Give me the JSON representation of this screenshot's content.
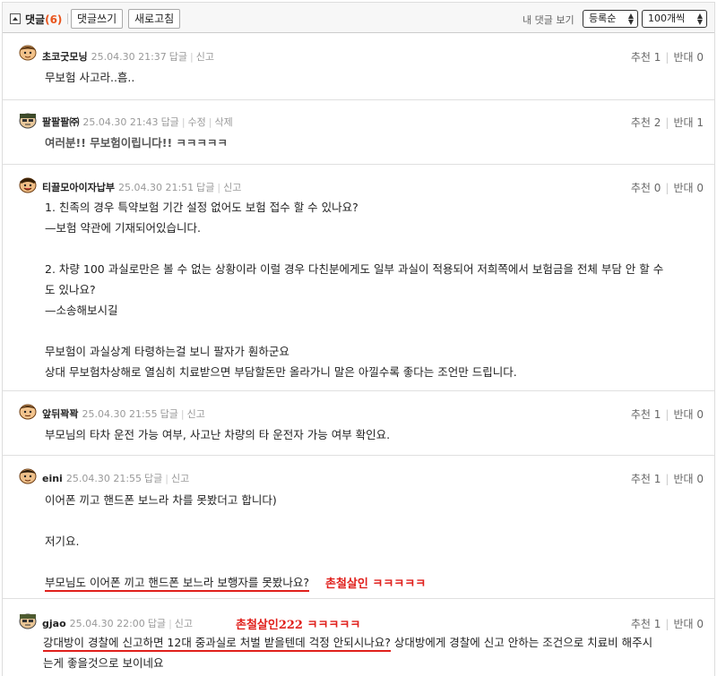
{
  "header": {
    "title": "댓글",
    "count": "(6)",
    "write_button": "댓글쓰기",
    "refresh_button": "새로고침",
    "my_comments": "내 댓글 보기",
    "sort_value": "등록순",
    "per_page_value": "100개씩"
  },
  "comments": [
    {
      "nick": "초코굿모닝",
      "date": "25.04.30 21:37",
      "links": [
        "답글",
        "신고"
      ],
      "up_label": "추천 1",
      "down_label": "반대 0",
      "body": "무보험 사고라..흠.."
    },
    {
      "nick": "팔팔팔㈜",
      "date": "25.04.30 21:43",
      "links": [
        "답글",
        "수정",
        "삭제"
      ],
      "up_label": "추천 2",
      "down_label": "반대 1",
      "body": "여러분!! 무보험이립니다!! ㅋㅋㅋㅋㅋ"
    },
    {
      "nick": "티끌모아이자납부",
      "date": "25.04.30 21:51",
      "links": [
        "답글",
        "신고"
      ],
      "up_label": "추천 0",
      "down_label": "반대 0",
      "body": "1. 친족의 경우 특약보험 기간 설정 없어도 보험 접수 할 수 있나요?\n—보험 약관에 기재되어있습니다.\n\n2. 차량 100 과실로만은 볼 수 없는 상황이라 이럴 경우 다친분에게도 일부 과실이 적용되어 저희쪽에서 보험금을 전체 부담 안 할 수\n도 있나요?\n—소송해보시길\n\n무보험이 과실상계 타령하는걸 보니 팔자가 훤하군요\n상대 무보험차상해로 열심히 치료받으면 부담할돈만 올라가니 말은 아낄수록 좋다는 조언만 드립니다."
    },
    {
      "nick": "앞뒤꽉꽉",
      "date": "25.04.30 21:55",
      "links": [
        "답글",
        "신고"
      ],
      "up_label": "추천 1",
      "down_label": "반대 0",
      "body": "부모님의 타차 운전 가능 여부, 사고난 차량의 타 운전자 가능 여부 확인요."
    },
    {
      "nick": "eini",
      "date": "25.04.30 21:55",
      "links": [
        "답글",
        "신고"
      ],
      "up_label": "추천 1",
      "down_label": "반대 0",
      "body": "이어폰 끼고 핸드폰 보느라 차를 못봤더고 합니다)\n\n저기요.\n\n",
      "underlined_line": "부모님도 이어폰 끼고 핸드폰 보느라 보행자를 못봤나요?",
      "handwriting": "촌철살인 ㅋㅋㅋㅋㅋ"
    },
    {
      "nick": "gjao",
      "date": "25.04.30 22:00",
      "links": [
        "답글",
        "신고"
      ],
      "up_label": "추천 1",
      "down_label": "반대 0",
      "underlined_part": "강대방이 경찰에 신고하면 12대 중과실로 처벌 받을텐데 걱정 안되시나요?",
      "body_rest": " 상대방에게 경찰에 신고 안하는 조건으로 치료비 해주시",
      "body_line2": "는게 좋을것으로 보이네요",
      "handwriting": "촌철살인222 ㅋㅋㅋㅋㅋ"
    }
  ],
  "colors": {
    "accent": "#e8541c",
    "handwriting": "#e0201c"
  }
}
